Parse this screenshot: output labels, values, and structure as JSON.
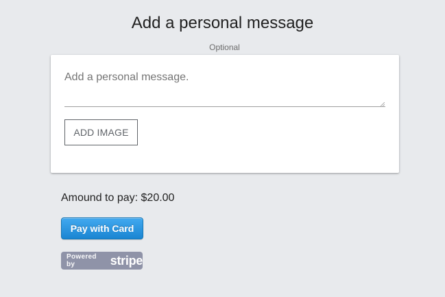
{
  "header": {
    "title": "Add a personal message",
    "subtitle": "Optional"
  },
  "message": {
    "placeholder": "Add a personal message.",
    "value": "",
    "add_image_label": "ADD IMAGE"
  },
  "payment": {
    "amount_text": "Amound to pay: $20.00",
    "pay_button_label": "Pay with Card",
    "badge": {
      "powered_by": "Powered by",
      "brand": "stripe"
    }
  },
  "colors": {
    "background": "#e8eaed",
    "card": "#ffffff",
    "pay_button_accent": "#1a85d2",
    "stripe_badge": "#8f93a8"
  },
  "icons": {
    "textarea_resize": "resize-grip-icon"
  }
}
